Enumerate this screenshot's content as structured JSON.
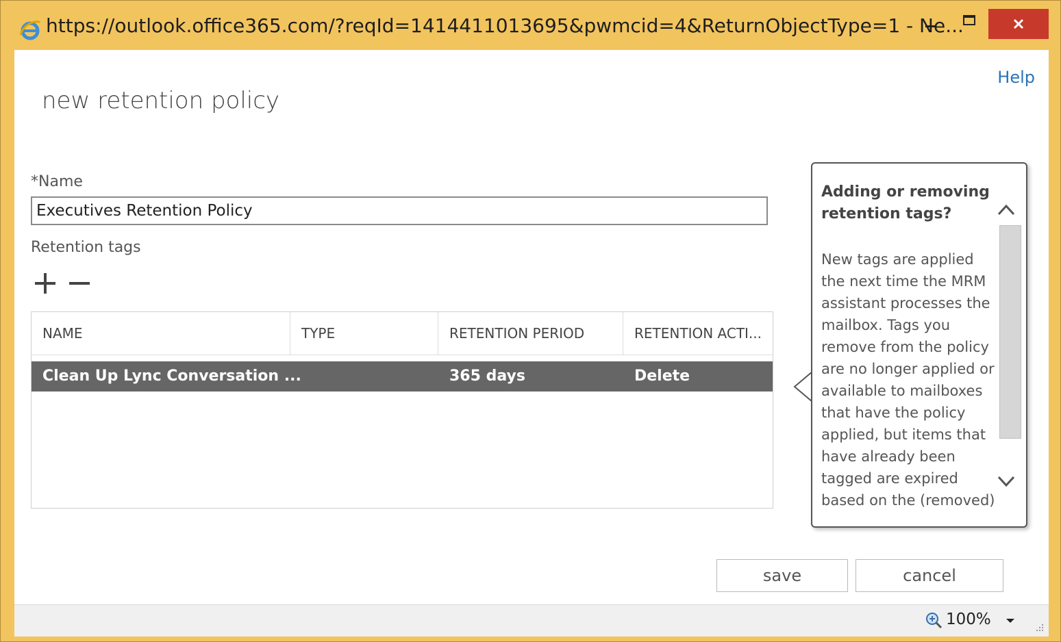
{
  "window": {
    "title": "https://outlook.office365.com/?reqId=1414411013695&pwmcid=4&ReturnObjectType=1 - Ne...",
    "accent_color": "#f2c45e",
    "close_color": "#c7392b"
  },
  "header": {
    "help_label": "Help",
    "page_title": "new retention policy"
  },
  "form": {
    "name_label": "*Name",
    "name_value": "Executives Retention Policy",
    "tags_label": "Retention tags",
    "add_icon": "plus-icon",
    "remove_icon": "minus-icon"
  },
  "table": {
    "columns": [
      "NAME",
      "TYPE",
      "RETENTION PERIOD",
      "RETENTION ACTI..."
    ],
    "rows": [
      {
        "name": "Clean Up Lync Conversation ...",
        "type": "",
        "period": "365 days",
        "action": "Delete",
        "selected": true
      }
    ],
    "selected_row_color": "#666666"
  },
  "callout": {
    "title": "Adding or removing retention tags?",
    "body": "New tags are applied the next time the MRM assistant processes the mailbox. Tags you remove from the policy are no longer applied or available to mailboxes that have the policy applied, but items that have already been tagged are expired based on the (removed)"
  },
  "buttons": {
    "save": "save",
    "cancel": "cancel"
  },
  "status": {
    "zoom": "100%",
    "zoom_icon": "zoom-magnifier-icon"
  }
}
